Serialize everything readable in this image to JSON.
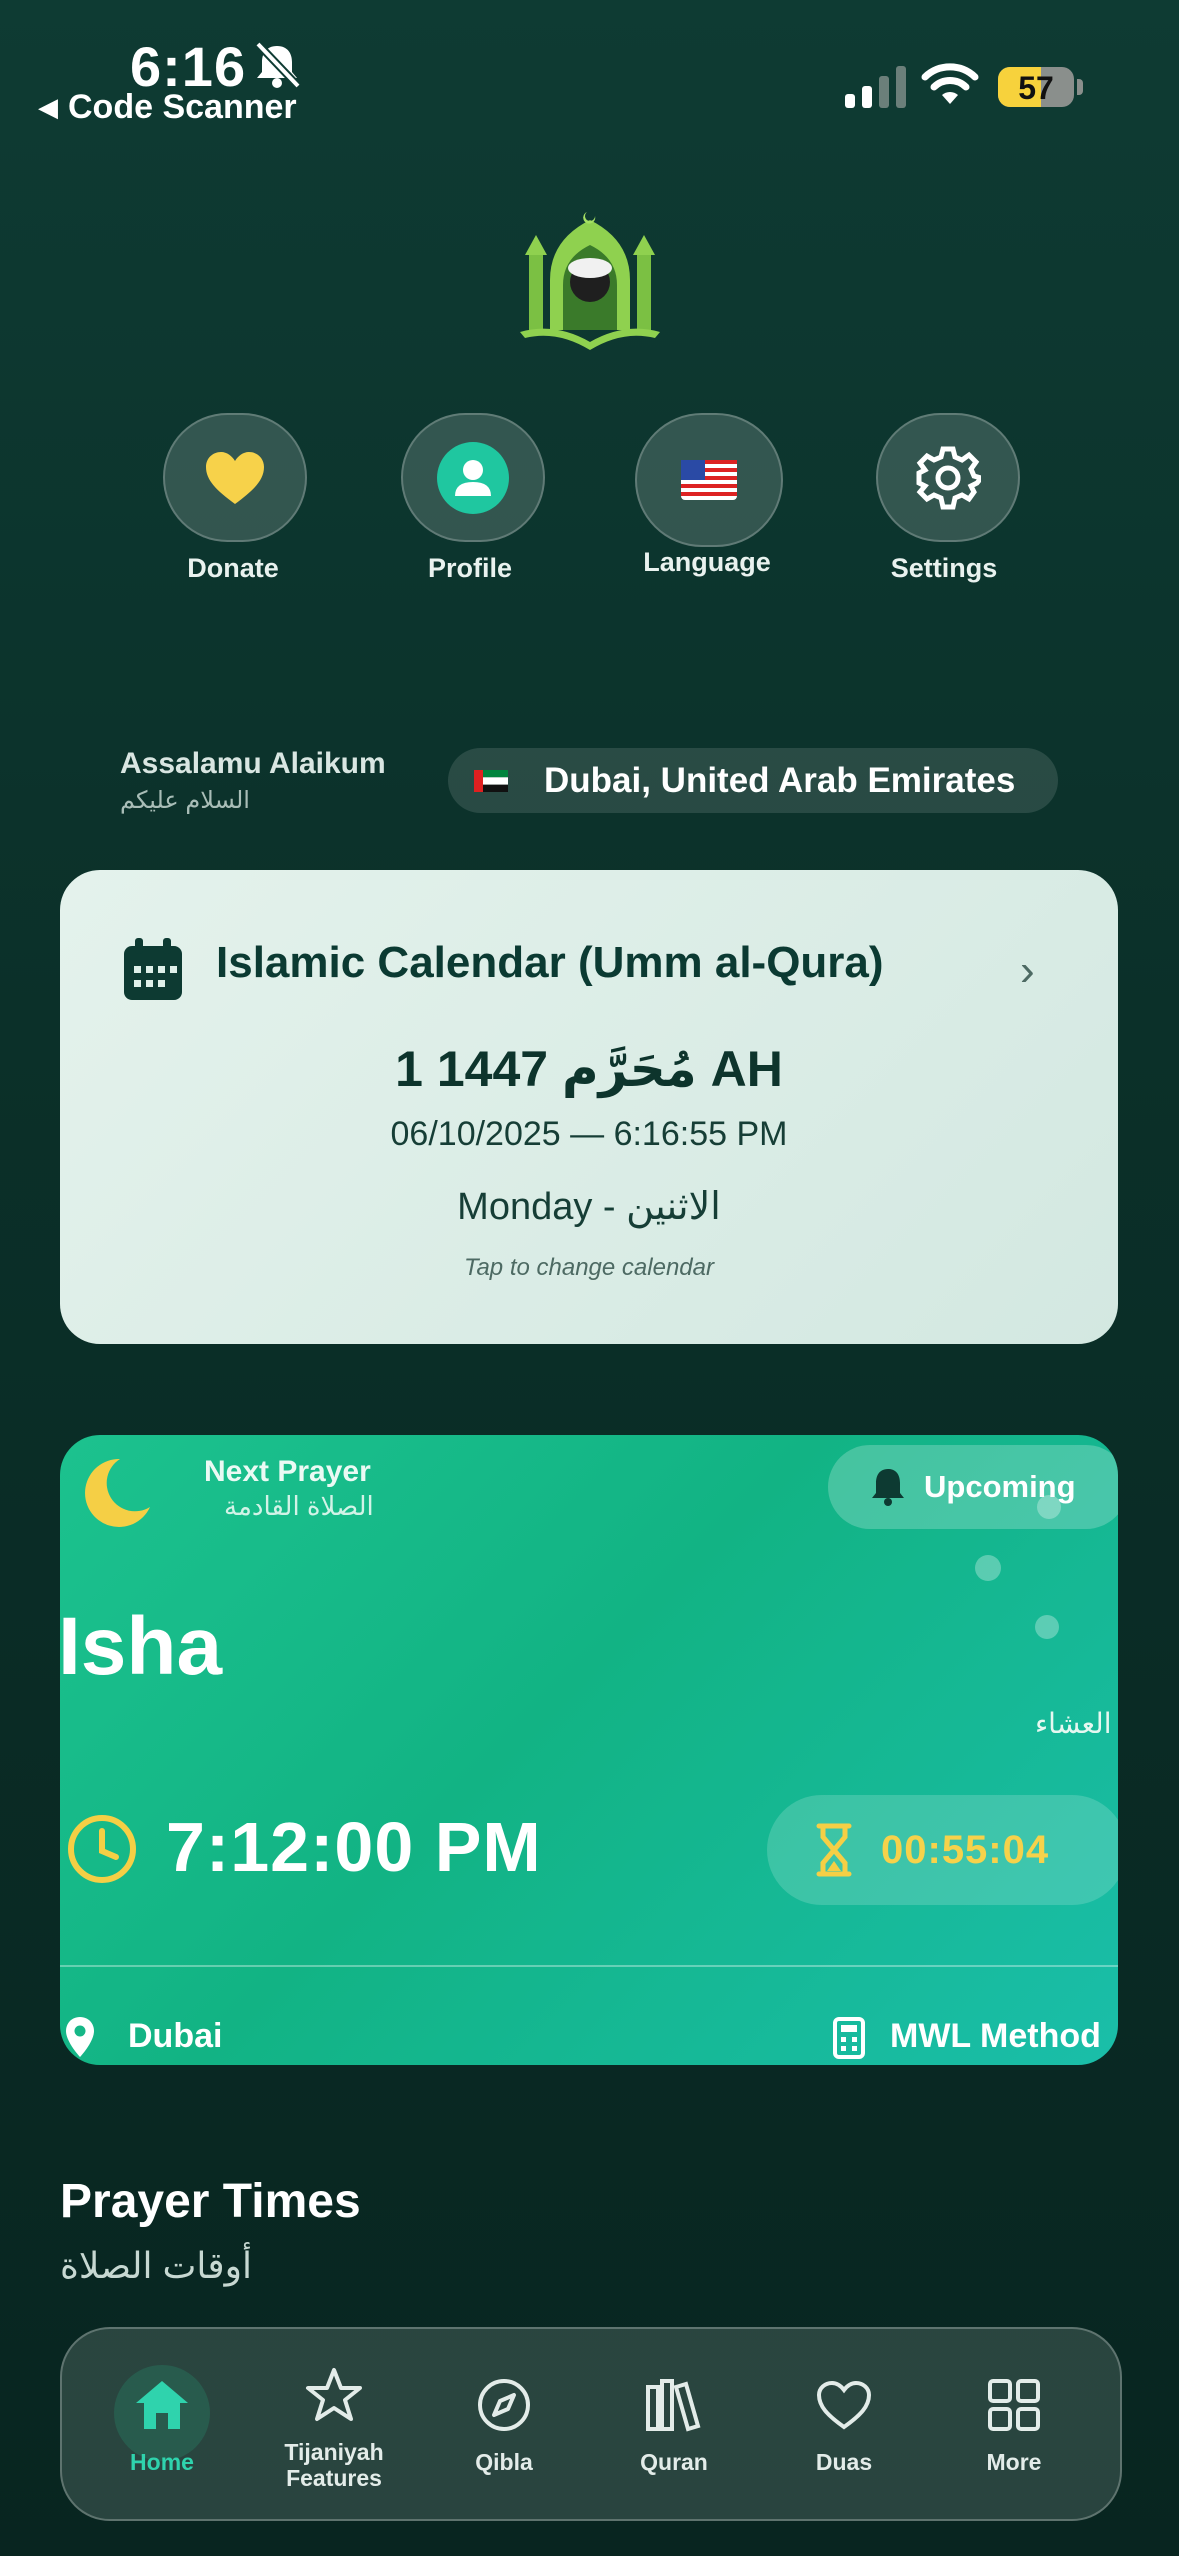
{
  "status_bar": {
    "time": "6:16",
    "back_app": "Code Scanner",
    "battery": "57"
  },
  "quick_actions": [
    {
      "label": "Donate"
    },
    {
      "label": "Profile"
    },
    {
      "label": "Language"
    },
    {
      "label": "Settings"
    }
  ],
  "greeting": {
    "en": "Assalamu Alaikum",
    "ar": "السلام عليكم"
  },
  "location": {
    "name": "Dubai, United Arab Emirates"
  },
  "calendar": {
    "title": "Islamic Calendar (Umm al-Qura)",
    "hijri_date": "1 مُحَرَّم 1447 AH",
    "gregorian": "06/10/2025 — 6:16:55 PM",
    "weekday": "Monday - الاثنين",
    "hint": "Tap to change calendar"
  },
  "next_prayer": {
    "label": "Next Prayer",
    "label_ar": "الصلاة القادمة",
    "badge": "Upcoming",
    "name": "Isha",
    "name_ar": "العشاء",
    "time": "7:12:00 PM",
    "countdown": "00:55:04",
    "city": "Dubai",
    "method": "MWL Method"
  },
  "section": {
    "title": "Prayer Times",
    "title_ar": "أوقات الصلاة"
  },
  "tabbar": [
    {
      "label": "Home",
      "active": true
    },
    {
      "label": "Tijaniyah Features"
    },
    {
      "label": "Qibla"
    },
    {
      "label": "Quran"
    },
    {
      "label": "Duas"
    },
    {
      "label": "More"
    }
  ],
  "colors": {
    "accent": "#2fd3ad",
    "card_green": "#15b787",
    "gold": "#f6d24b",
    "background": "#0b3029"
  }
}
